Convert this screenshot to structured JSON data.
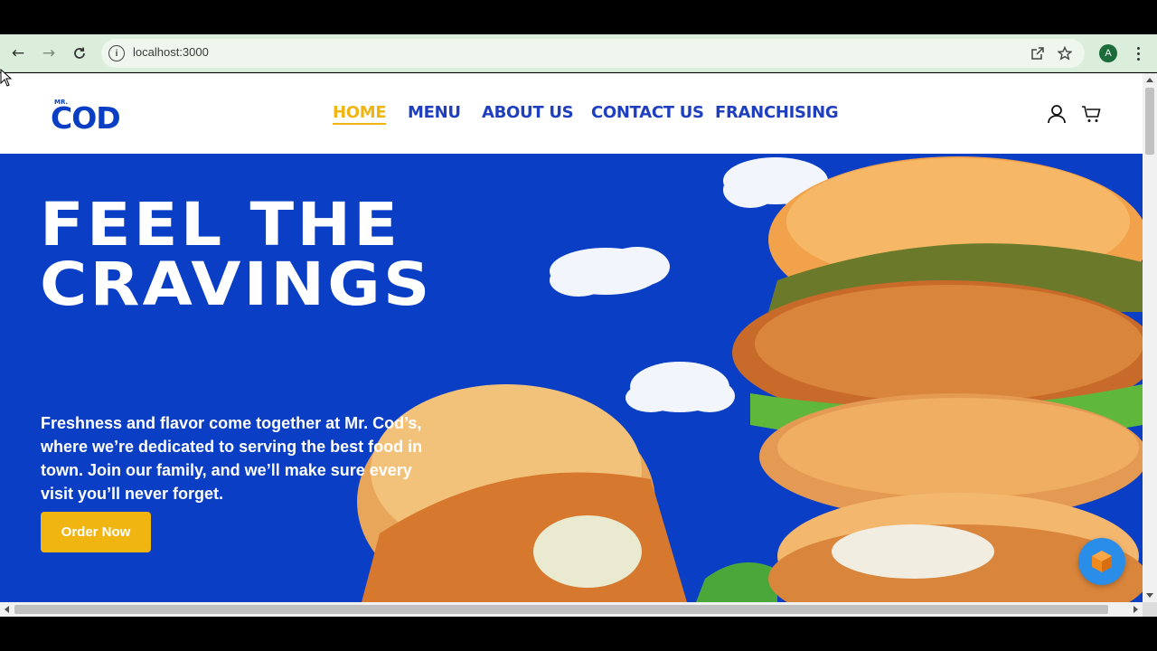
{
  "browser": {
    "url": "localhost:3000",
    "profile_initial": "A",
    "icons": [
      "back-arrow-icon",
      "forward-arrow-icon",
      "reload-icon",
      "site-info-icon",
      "open-in-app-icon",
      "bookmark-star-icon",
      "menu-kebab-icon"
    ]
  },
  "site": {
    "logo_small": "MR.",
    "logo_big": "COD",
    "nav": [
      "HOME",
      "MENU",
      "ABOUT US",
      "CONTACT US",
      "FRANCHISING"
    ],
    "active_nav": "HOME",
    "header_icons": [
      "user-icon",
      "cart-icon"
    ]
  },
  "hero": {
    "title_line1": "FEEL THE",
    "title_line2": "CRAVINGS",
    "text": "Freshness and flavor come together at Mr. Cod’s, where we’re dedicated to serving the best food in town. Join our family, and we’ll make sure every visit you’ll never forget.",
    "cta": "Order Now"
  },
  "colors": {
    "brand_blue": "#0a3ec4",
    "accent_yellow": "#f0b510",
    "nav_blue": "#1f3fbf"
  }
}
